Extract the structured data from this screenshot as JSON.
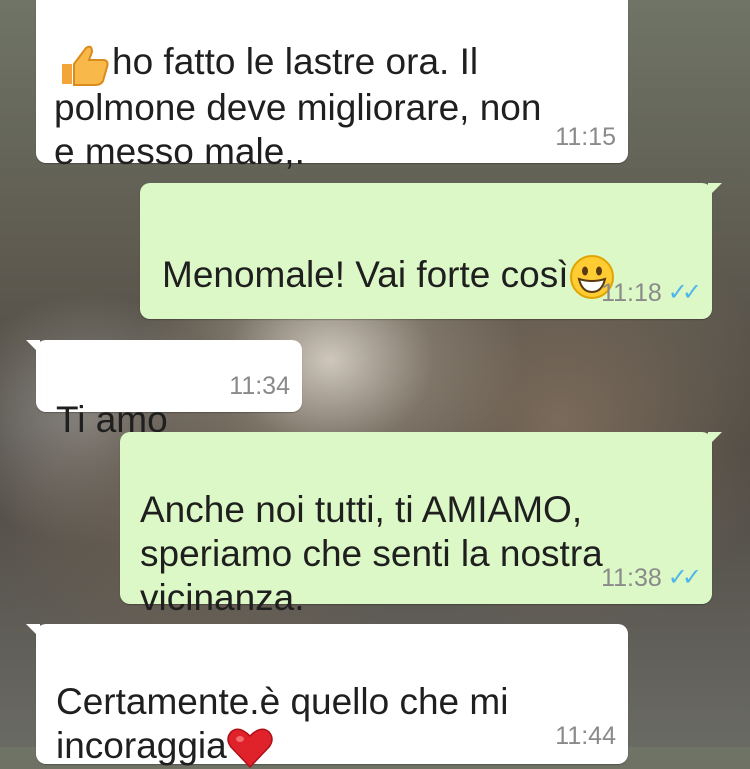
{
  "conversation": {
    "messages": [
      {
        "direction": "incoming",
        "emoji": "thumbs-up",
        "text": "ho fatto le lastre ora. Il\npolmone deve migliorare, non\ne messo male,.",
        "time": "11:15"
      },
      {
        "direction": "outgoing",
        "emoji": "grinning-face",
        "text": "Menomale! Vai forte così",
        "time": "11:18",
        "status": "read"
      },
      {
        "direction": "incoming",
        "text": "Ti amo",
        "time": "11:34"
      },
      {
        "direction": "outgoing",
        "text": "Anche noi tutti, ti AMIAMO,\nsperiamo che senti la nostra\nvicinanza.",
        "time": "11:38",
        "status": "read"
      },
      {
        "direction": "incoming",
        "emoji": "red-heart",
        "text": "Certamente.è quello che mi\nincoraggia",
        "time": "11:44"
      }
    ],
    "read_tick_color": "#4fb6ec",
    "incoming_bubble_color": "#ffffff",
    "outgoing_bubble_color": "#dcf8c6"
  }
}
